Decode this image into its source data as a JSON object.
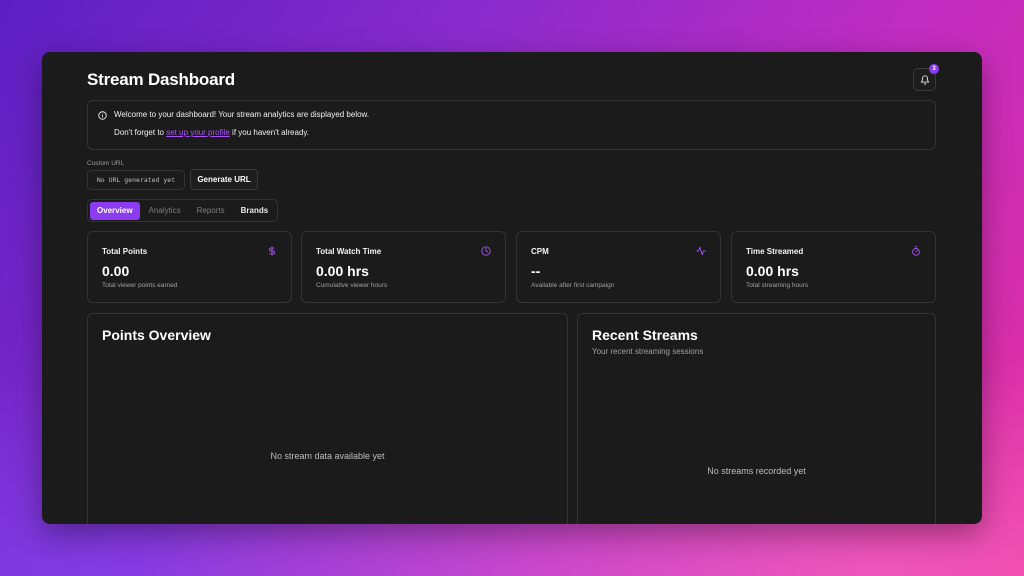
{
  "header": {
    "title": "Stream Dashboard",
    "notification_count": "3"
  },
  "notice": {
    "line1": "Welcome to your dashboard! Your stream analytics are displayed below.",
    "line2_prefix": "Don't forget to ",
    "line2_link": "set up your profile",
    "line2_suffix": " if you haven't already."
  },
  "custom_url": {
    "label": "Custom URL",
    "value": "No URL generated yet",
    "button": "Generate URL"
  },
  "tabs": [
    {
      "label": "Overview",
      "active": true
    },
    {
      "label": "Analytics",
      "active": false
    },
    {
      "label": "Reports",
      "active": false
    },
    {
      "label": "Brands",
      "active": false
    }
  ],
  "stats": [
    {
      "title": "Total Points",
      "value": "0.00",
      "sub": "Total viewer points earned",
      "icon": "dollar-icon"
    },
    {
      "title": "Total Watch Time",
      "value": "0.00 hrs",
      "sub": "Cumulative viewer hours",
      "icon": "clock-icon"
    },
    {
      "title": "CPM",
      "value": "--",
      "sub": "Available after first campaign",
      "icon": "activity-icon"
    },
    {
      "title": "Time Streamed",
      "value": "0.00 hrs",
      "sub": "Total streaming hours",
      "icon": "timer-icon"
    }
  ],
  "points_overview": {
    "title": "Points Overview",
    "empty": "No stream data available yet"
  },
  "recent_streams": {
    "title": "Recent Streams",
    "subtitle": "Your recent streaming sessions",
    "empty": "No streams recorded yet"
  },
  "colors": {
    "accent": "#8b3cf0",
    "background": "#1b1b1b",
    "border": "#333333"
  }
}
